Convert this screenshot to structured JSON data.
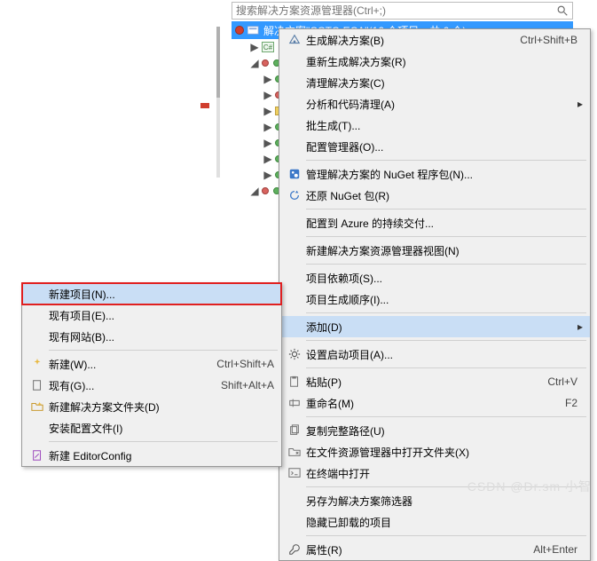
{
  "search": {
    "placeholder": "搜索解决方案资源管理器(Ctrl+;)"
  },
  "selected_row": {
    "label": "解决方案\"CCTC-ECA\"(16 个项目，共 6 个)"
  },
  "ctx1": {
    "build": "生成解决方案(B)",
    "build_sc": "Ctrl+Shift+B",
    "rebuild": "重新生成解决方案(R)",
    "clean": "清理解决方案(C)",
    "analyze": "分析和代码清理(A)",
    "batch": "批生成(T)...",
    "config": "配置管理器(O)...",
    "nuget_manage": "管理解决方案的 NuGet 程序包(N)...",
    "nuget_restore": "还原 NuGet 包(R)",
    "azure": "配置到 Azure 的持续交付...",
    "new_view": "新建解决方案资源管理器视图(N)",
    "deps": "项目依赖项(S)...",
    "order": "项目生成顺序(I)...",
    "add": "添加(D)",
    "startup": "设置启动项目(A)...",
    "paste": "粘贴(P)",
    "paste_sc": "Ctrl+V",
    "rename": "重命名(M)",
    "rename_sc": "F2",
    "copy_path": "复制完整路径(U)",
    "open_explorer": "在文件资源管理器中打开文件夹(X)",
    "open_terminal": "在终端中打开",
    "save_filter": "另存为解决方案筛选器",
    "hide_unloaded": "隐藏已卸载的项目",
    "properties": "属性(R)",
    "properties_sc": "Alt+Enter"
  },
  "ctx2": {
    "new_project": "新建项目(N)...",
    "existing_project": "现有项目(E)...",
    "existing_site": "现有网站(B)...",
    "new_item": "新建(W)...",
    "new_item_sc": "Ctrl+Shift+A",
    "existing_item": "现有(G)...",
    "existing_item_sc": "Shift+Alt+A",
    "new_sln_folder": "新建解决方案文件夹(D)",
    "install_config": "安装配置文件(I)",
    "editorconfig": "新建 EditorConfig"
  },
  "watermark": "CSDN @Dr.sm 小智"
}
